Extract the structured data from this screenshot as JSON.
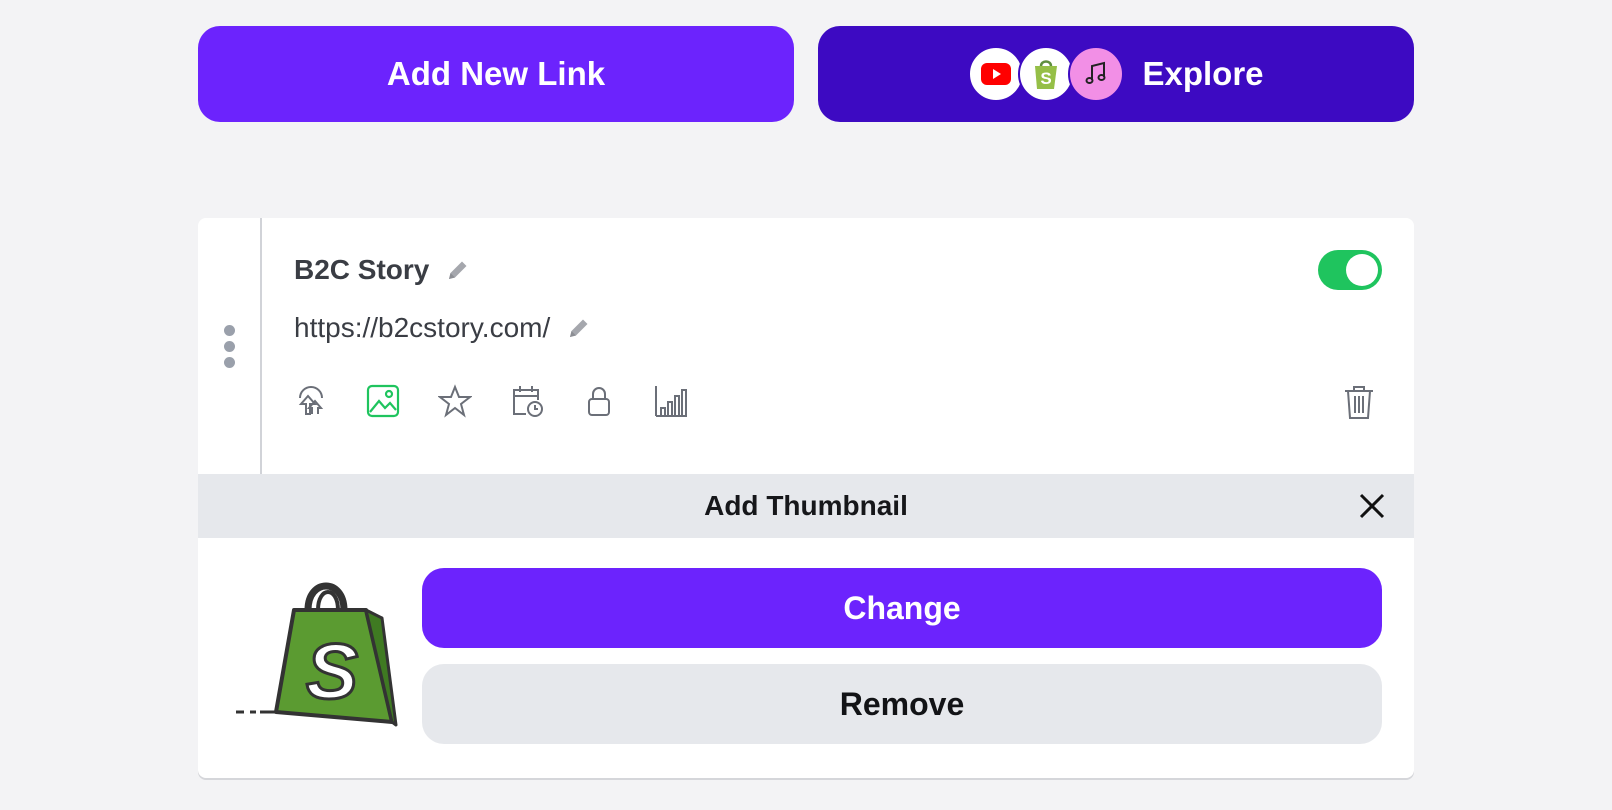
{
  "top_actions": {
    "add_link_label": "Add New Link",
    "explore_label": "Explore",
    "explore_icons": [
      "youtube-icon",
      "shopify-icon",
      "music-icon"
    ]
  },
  "link_card": {
    "title": "B2C Story",
    "url": "https://b2cstory.com/",
    "enabled": true,
    "tools": [
      "redirect-icon",
      "thumbnail-icon",
      "star-icon",
      "schedule-icon",
      "lock-icon",
      "analytics-icon"
    ],
    "active_tool": "thumbnail-icon",
    "thumbnail_panel": {
      "title": "Add Thumbnail",
      "change_label": "Change",
      "remove_label": "Remove"
    }
  },
  "colors": {
    "primary": "#6c23fd",
    "explore": "#3d0ac2",
    "toggle_on": "#1fc45e",
    "active_tool": "#1fc45e",
    "panel_bg": "#e6e8ec"
  }
}
